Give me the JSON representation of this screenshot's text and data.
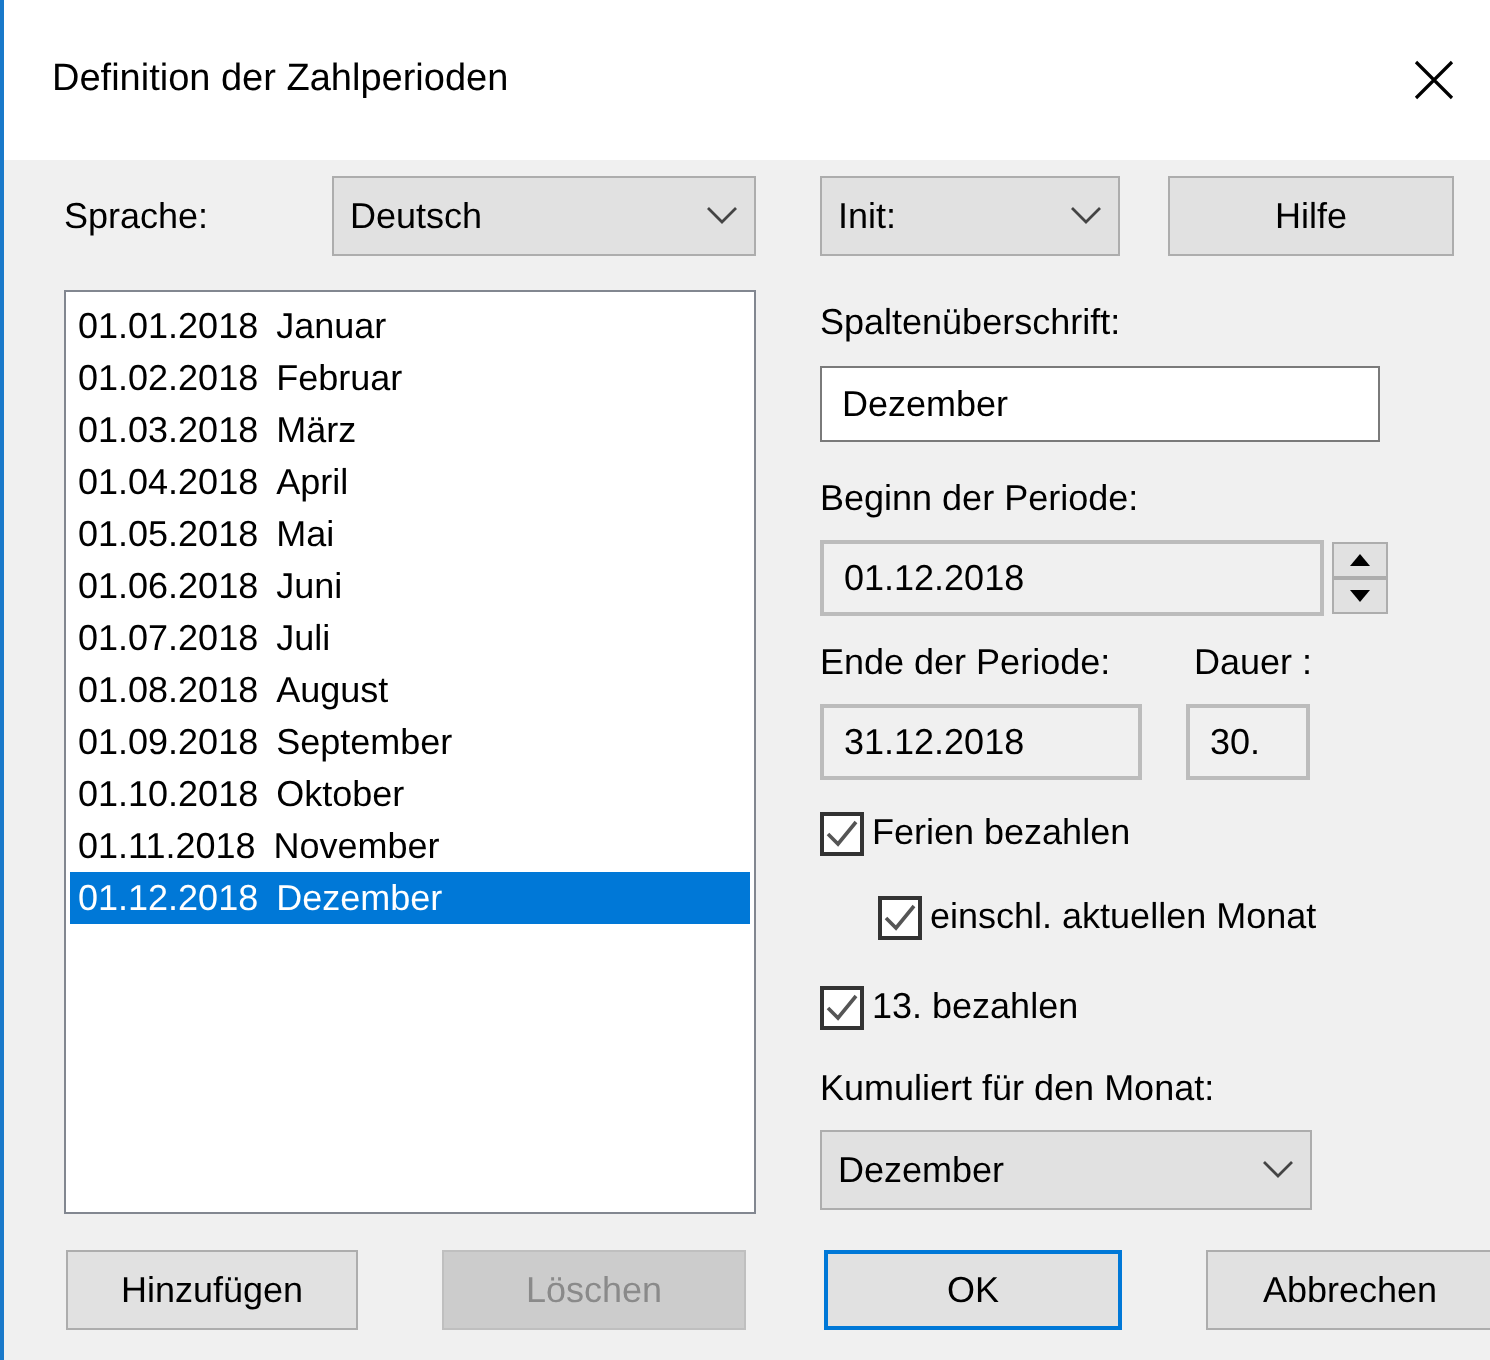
{
  "window": {
    "title": "Definition der Zahlperioden"
  },
  "language": {
    "label": "Sprache:",
    "value": "Deutsch"
  },
  "init": {
    "value": "Init:"
  },
  "help_button": {
    "label": "Hilfe"
  },
  "periods": [
    {
      "date": "01.01.2018",
      "name": "Januar",
      "selected": false
    },
    {
      "date": "01.02.2018",
      "name": "Februar",
      "selected": false
    },
    {
      "date": "01.03.2018",
      "name": "März",
      "selected": false
    },
    {
      "date": "01.04.2018",
      "name": "April",
      "selected": false
    },
    {
      "date": "01.05.2018",
      "name": "Mai",
      "selected": false
    },
    {
      "date": "01.06.2018",
      "name": "Juni",
      "selected": false
    },
    {
      "date": "01.07.2018",
      "name": "Juli",
      "selected": false
    },
    {
      "date": "01.08.2018",
      "name": "August",
      "selected": false
    },
    {
      "date": "01.09.2018",
      "name": "September",
      "selected": false
    },
    {
      "date": "01.10.2018",
      "name": "Oktober",
      "selected": false
    },
    {
      "date": "01.11.2018",
      "name": "November",
      "selected": false
    },
    {
      "date": "01.12.2018",
      "name": "Dezember",
      "selected": true
    }
  ],
  "column_heading": {
    "label": "Spaltenüberschrift:",
    "value": "Dezember",
    "readonly": false
  },
  "period_start": {
    "label": "Beginn der Periode:",
    "value": "01.12.2018",
    "readonly": true
  },
  "period_end": {
    "label": "Ende der Periode:",
    "value": "31.12.2018",
    "readonly": true
  },
  "duration": {
    "label": "Dauer :",
    "value": "30.",
    "readonly": true
  },
  "checkboxes": [
    {
      "label": "Ferien bezahlen",
      "checked": true,
      "children": [
        {
          "label": "einschl. aktuellen Monat",
          "checked": true
        }
      ]
    },
    {
      "label": "13. bezahlen",
      "checked": true
    }
  ],
  "cumulated": {
    "label": "Kumuliert für den Monat:",
    "value": "Dezember"
  },
  "buttons": [
    {
      "label": "Hinzufügen",
      "disabled": false,
      "default": false
    },
    {
      "label": "Löschen",
      "disabled": true,
      "default": false
    },
    {
      "label": "OK",
      "disabled": false,
      "default": true
    },
    {
      "label": "Abbrechen",
      "disabled": false,
      "default": false
    }
  ]
}
